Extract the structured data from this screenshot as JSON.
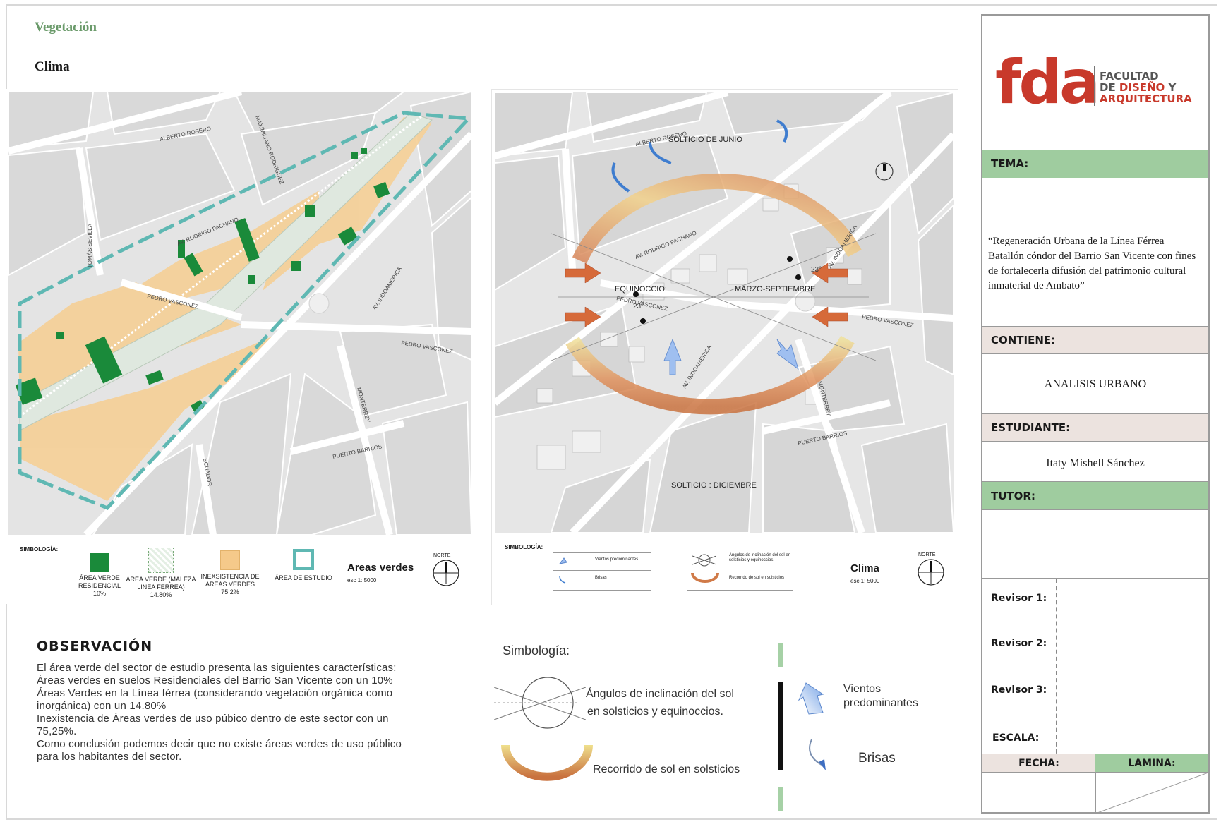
{
  "headings": {
    "vegetacion": "Vegetación",
    "clima": "Clima"
  },
  "streets": {
    "alberto_rosero": "ALBERTO ROSERO",
    "maximiliano": "MAXIMILIANO RODRIGUEZ",
    "tomas_sevilla": "TOMÁS SEVILLA",
    "rodrigo_pachano": "AV. RODRIGO PACHANO",
    "pedro_vasconez": "PEDRO VASCONEZ",
    "indoamerica": "AV. INDOAMERICA",
    "monterrey": "MONTERREY",
    "puerto_barrios": "PUERTO BARRIOS",
    "ecuador": "ECUADOR"
  },
  "map_left": {
    "legend_title": "SIMBOLOGÍA:",
    "items": [
      {
        "label": "ÁREA VERDE RESIDENCIAL",
        "value": "10%",
        "color": "#1a8a3a"
      },
      {
        "label": "ÁREA VERDE (MALEZA LÍNEA FERREA)",
        "value": "14.80%",
        "color": "#d9ead9"
      },
      {
        "label": "INEXSISTENCIA DE ÁREAS VERDES",
        "value": "75.2%",
        "color": "#f5c98a"
      },
      {
        "label": "ÁREA DE ESTUDIO",
        "value": "",
        "color": "#5fb8b3"
      }
    ],
    "map_title": "Areas verdes",
    "scale": "esc   1: 5000",
    "north": "NORTE"
  },
  "map_right": {
    "legend_title": "SIMBOLOGÍA:",
    "items": [
      {
        "label": "Vientos predominantes"
      },
      {
        "label": "Brisas"
      },
      {
        "label": "Ángulos de inclinación del sol en solsticios y equinoccios."
      },
      {
        "label": "Recorrido de sol en solsticios"
      }
    ],
    "solstice_june": "SOLTICIO DE JUNIO",
    "solstice_dec": "SOLTICIO : DICIEMBRE",
    "equinox": "EQUINOCCIO:",
    "equinox_months": "MARZO-SEPTIEMBRE",
    "angle": "23°",
    "map_title": "Clima",
    "scale": "esc   1: 5000",
    "north": "NORTE"
  },
  "observation": {
    "title": "OBSERVACIÓN",
    "lines": [
      "El área verde del sector de estudio presenta las siguientes características:",
      "Áreas verdes en suelos Residenciales del Barrio San Vicente con un 10%",
      "Áreas Verdes en la Línea férrea (considerando vegetación orgánica como",
      "inorgánica) con un 14.80%",
      "Inexistencia de Áreas verdes de uso púbico dentro de este sector con un",
      "75,25%.",
      "Como conclusión podemos decir que no existe áreas verdes de uso público",
      "para los habitantes del sector."
    ]
  },
  "symbology": {
    "title": "Simbología:",
    "sun_angles": "Ángulos de inclinación del sol",
    "sun_angles2": "en solsticios y equinoccios.",
    "sun_path": "Recorrido de sol en solsticios",
    "winds": "Vientos",
    "winds2": "predominantes",
    "breezes": "Brisas"
  },
  "title_block": {
    "logo_letters": "fda",
    "faculty1": "FACULTAD",
    "faculty2a": "DE ",
    "faculty2b": "DISEÑO",
    "faculty2c": " Y",
    "faculty3": "ARQUITECTURA",
    "tema_label": "TEMA:",
    "tema_text": "“Regeneración Urbana de la Línea Férrea Batallón cóndor del Barrio San Vicente con fines de fortalecerla difusión del patrimonio cultural inmaterial de Ambato”",
    "contiene_label": "CONTIENE:",
    "contiene_text": "ANALISIS URBANO",
    "estudiante_label": "ESTUDIANTE:",
    "estudiante_text": "Itaty Mishell Sánchez",
    "tutor_label": "TUTOR:",
    "revisor1": "Revisor 1:",
    "revisor2": "Revisor 2:",
    "revisor3": "Revisor 3:",
    "escala": "ESCALA:",
    "fecha": "FECHA:",
    "lamina": "LAMINA:"
  },
  "colors": {
    "green_head": "#9fcc9f",
    "beige_head": "#ece3df",
    "brand_red": "#c8392b",
    "brand_gray": "#555555"
  }
}
